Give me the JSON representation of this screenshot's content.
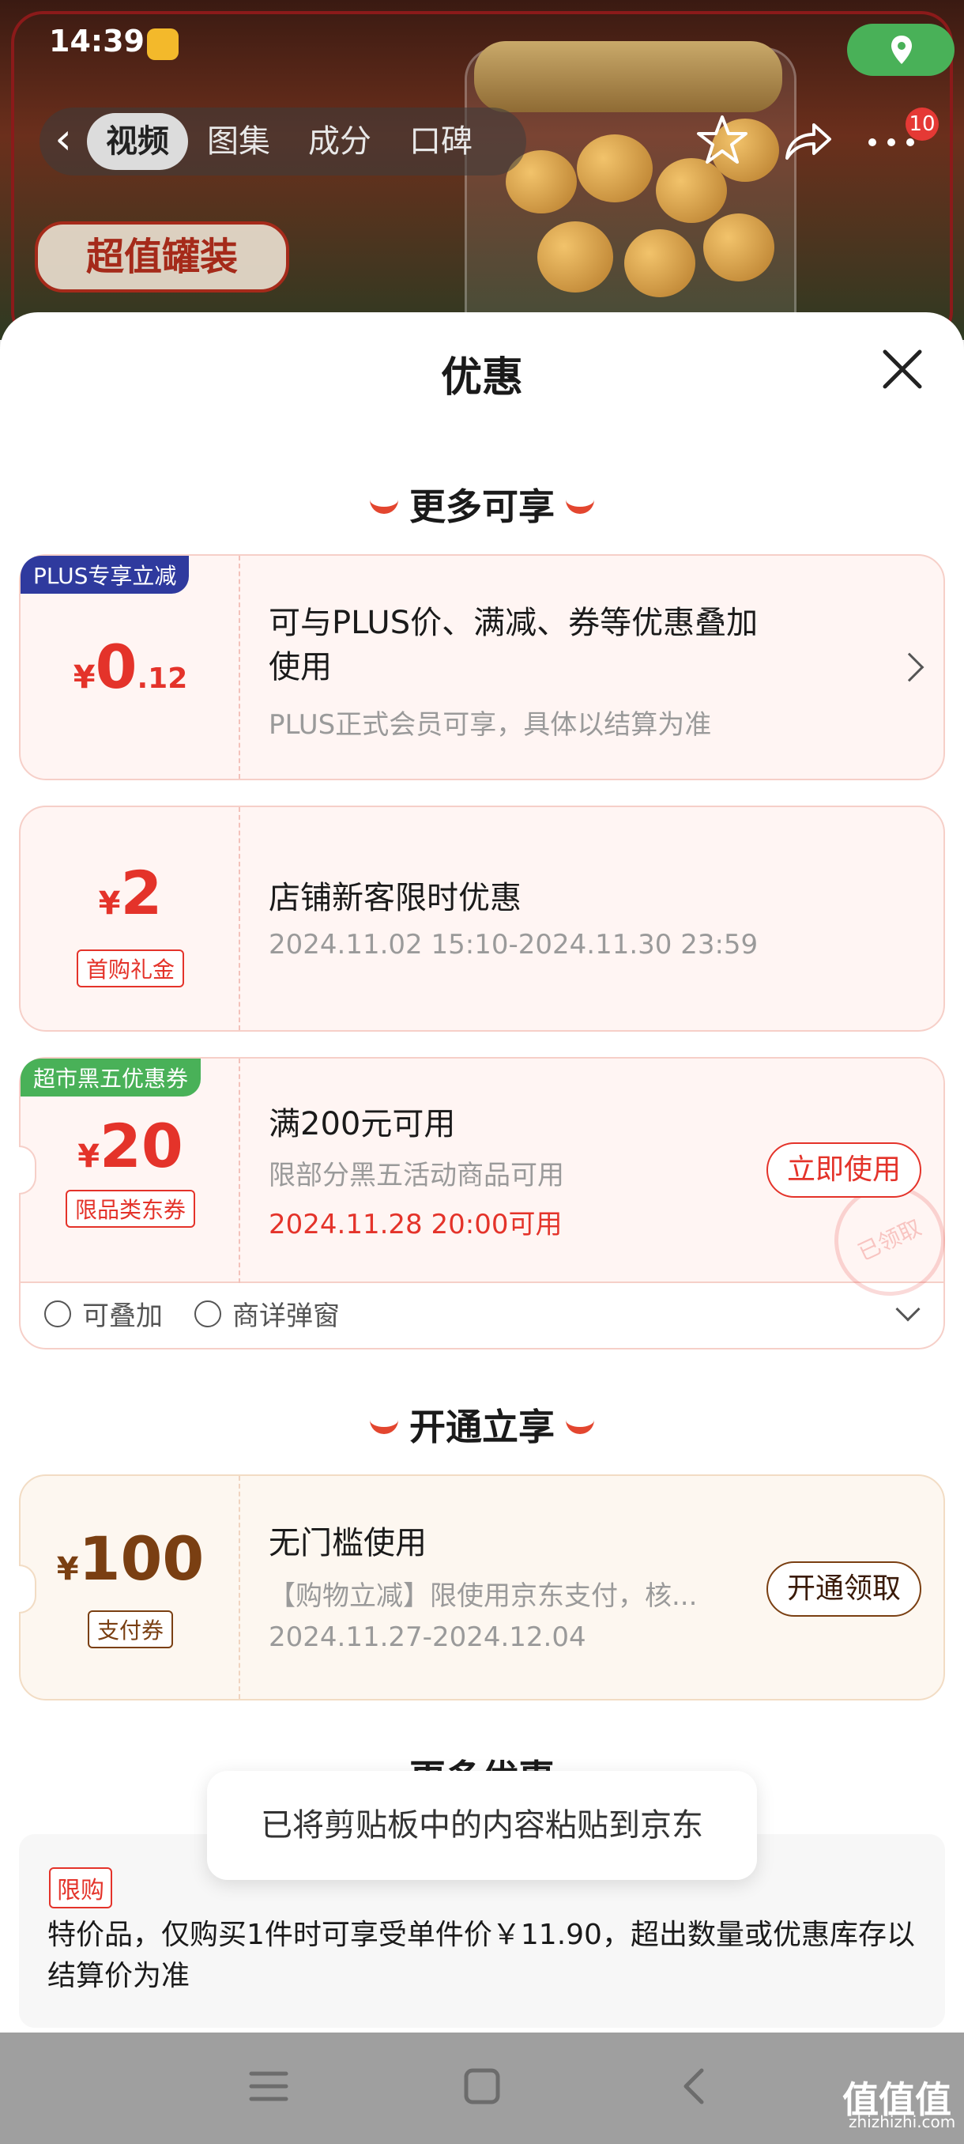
{
  "status_bar": {
    "time": "14:39"
  },
  "header": {
    "tabs": [
      {
        "label": "视频",
        "active": true
      },
      {
        "label": "图集",
        "active": false
      },
      {
        "label": "成分",
        "active": false
      },
      {
        "label": "口碑",
        "active": false
      }
    ],
    "message_count": "10",
    "badge_text": "超值罐装"
  },
  "sheet": {
    "title": "优惠",
    "section1_title": "更多可享",
    "section2_title": "开通立享",
    "section3_title": "更多优惠"
  },
  "coupons": [
    {
      "corner_tag": "PLUS专享立减",
      "currency": "¥",
      "amount_int": "0",
      "amount_dec": ".12",
      "title_line1": "可与PLUS价、满减、券等优惠叠加",
      "title_line2": "使用",
      "subtitle": "PLUS正式会员可享，具体以结算为准"
    },
    {
      "currency": "¥",
      "amount": "2",
      "tag": "首购礼金",
      "title": "店铺新客限时优惠",
      "subtitle": "2024.11.02 15:10-2024.11.30 23:59"
    },
    {
      "corner_tag": "超市黑五优惠券",
      "currency": "¥",
      "amount": "20",
      "tag": "限品类东券",
      "title": "满200元可用",
      "subtitle": "限部分黑五活动商品可用",
      "available_at": "2024.11.28 20:00可用",
      "button": "立即使用",
      "stamp": "已领取",
      "features": [
        "可叠加",
        "商详弹窗"
      ]
    },
    {
      "currency": "¥",
      "amount": "100",
      "tag": "支付券",
      "title": "无门槛使用",
      "subtitle": "【购物立减】限使用京东支付，核...",
      "validity": "2024.11.27-2024.12.04",
      "button": "开通领取"
    }
  ],
  "limit_info": {
    "tag": "限购",
    "text": "特价品，仅购买1件时可享受单件价￥11.90，超出数量或优惠库存以结算价为准"
  },
  "toast": "已将剪贴板中的内容粘贴到京东",
  "watermark": {
    "main": "值值值",
    "sub": "zhizhizhi.com"
  },
  "colors": {
    "accent_red": "#e4332a",
    "plus_blue": "#2f3a9e",
    "green_tag": "#49b158",
    "gold_brown": "#7a3f12"
  }
}
